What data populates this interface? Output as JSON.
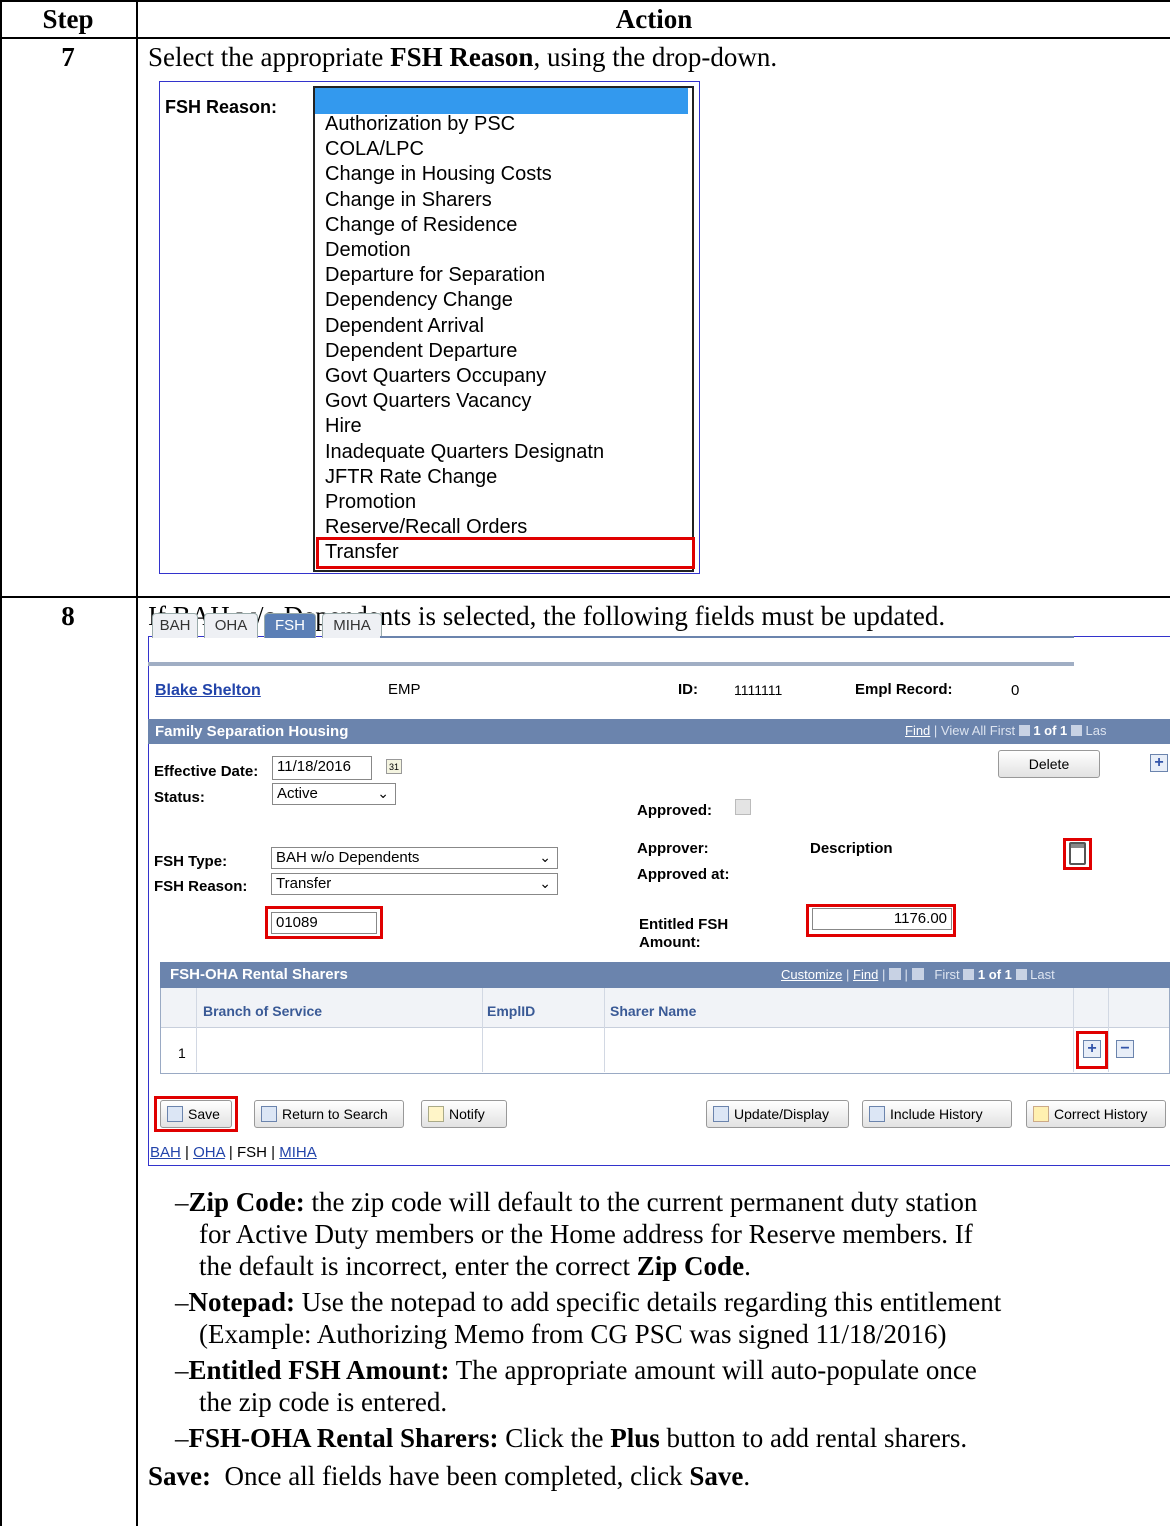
{
  "header": {
    "step": "Step",
    "action": "Action"
  },
  "step7": {
    "number": "7",
    "instruction_pre": "Select the appropriate ",
    "instruction_bold": "FSH Reason",
    "instruction_post": ", using the drop-down.",
    "field_label": "FSH Reason:",
    "options": [
      "Authorization by PSC",
      "COLA/LPC",
      "Change in Housing Costs",
      "Change in Sharers",
      "Change of Residence",
      "Demotion",
      "Departure for Separation",
      "Dependency Change",
      "Dependent Arrival",
      "Dependent Departure",
      "Govt Quarters Occupany",
      "Govt Quarters Vacancy",
      "Hire",
      "Inadequate Quarters Designatn",
      "JFTR Rate Change",
      "Promotion",
      "Reserve/Recall Orders",
      "Transfer"
    ]
  },
  "step8": {
    "number": "8",
    "instruction": "If BAH w/o Dependents is selected, the following fields must be updated.",
    "tabs": [
      "BAH",
      "OHA",
      "FSH",
      "MIHA"
    ],
    "name": "Blake Shelton",
    "emp": "EMP",
    "id_label": "ID:",
    "id_value": "1111111",
    "empl_record_label": "Empl Record:",
    "empl_record_value": "0",
    "section_title": "Family Separation Housing",
    "nav_find": "Find",
    "nav_rest": " | View All   First",
    "nav_count": "1 of 1",
    "nav_last": "Las",
    "effective_date_label": "Effective Date:",
    "effective_date": "11/18/2016",
    "delete_label": "Delete",
    "status_label": "Status:",
    "status_value": "Active",
    "approved_label": "Approved:",
    "approver_label": "Approver:",
    "description_label": "Description",
    "approved_at_label": "Approved at:",
    "fsh_type_label": "FSH Type:",
    "fsh_type_value": "BAH w/o Dependents",
    "fsh_reason_label": "FSH Reason:",
    "fsh_reason_value": "Transfer",
    "zip_value": "01089",
    "entitled_label_1": "Entitled FSH",
    "entitled_label_2": "Amount:",
    "entitled_value": "1176.00",
    "sharers_title": "FSH-OHA Rental Sharers",
    "sharers_nav_customize": "Customize",
    "sharers_nav_find": "Find",
    "sharers_nav_first": "First",
    "sharers_nav_count": "1 of 1",
    "sharers_nav_last": "Last",
    "col_branch": "Branch of Service",
    "col_emplid": "EmplID",
    "col_sharer": "Sharer Name",
    "row_num": "1",
    "buttons": {
      "save": "Save",
      "return": "Return to Search",
      "notify": "Notify",
      "update": "Update/Display",
      "include": "Include History",
      "correct": "Correct History"
    },
    "bottom_links": [
      "BAH",
      "OHA",
      "FSH",
      "MIHA"
    ],
    "bullets": [
      {
        "bold": "Zip Code:",
        "lines": [
          " the zip code will default to the current permanent duty station",
          "for Active Duty members or the Home address for Reserve members. If",
          "the default is incorrect, enter the correct "
        ],
        "tail_bold": "Zip Code",
        "tail": "."
      },
      {
        "bold": "Notepad:",
        "lines": [
          " Use the notepad to add specific details regarding this entitlement",
          "(Example: Authorizing Memo from CG PSC was signed 11/18/2016)"
        ]
      },
      {
        "bold": "Entitled FSH Amount:",
        "lines": [
          " The appropriate amount will auto-populate once",
          "the zip code is entered."
        ]
      },
      {
        "bold": "FSH-OHA Rental Sharers:",
        "lines": [
          " Click the "
        ],
        "mid_bold": "Plus",
        "tail": " button to add rental sharers."
      }
    ],
    "save_note_bold": "Save:",
    "save_note_pre": "  Once all fields have been completed, click ",
    "save_note_bold2": "Save",
    "save_note_post": "."
  }
}
